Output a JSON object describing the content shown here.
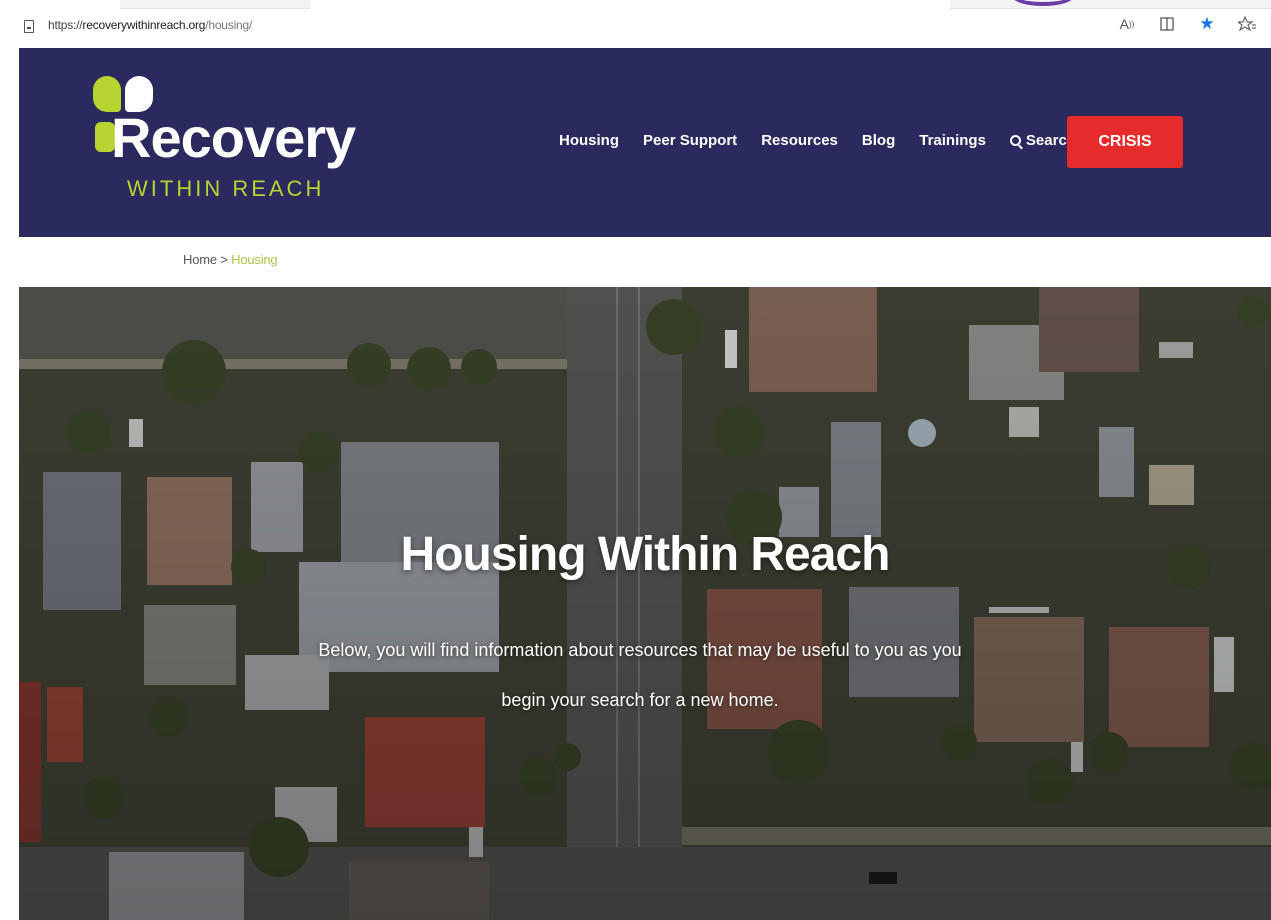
{
  "browser": {
    "url_prefix": "https://",
    "url_host": "recoverywithinreach.org",
    "url_path": "/housing/",
    "icons": [
      "read-aloud-icon",
      "immersive-reader-icon",
      "favorite-star-icon",
      "favorites-icon"
    ]
  },
  "site": {
    "logo_word": "Recovery",
    "logo_sub": "WITHIN REACH",
    "colors": {
      "header_bg": "#2b2a5e",
      "accent_green": "#b7d431",
      "crisis_red": "#e52b2b"
    },
    "nav": {
      "items": [
        "Housing",
        "Peer Support",
        "Resources",
        "Blog",
        "Trainings"
      ],
      "search_label": "Search",
      "crisis_label": "CRISIS"
    }
  },
  "breadcrumb": {
    "home": "Home",
    "separator": ">",
    "current": "Housing"
  },
  "hero": {
    "title": "Housing Within Reach",
    "text": "Below, you will find information about resources that may be useful to you as you begin your search for a new home."
  }
}
